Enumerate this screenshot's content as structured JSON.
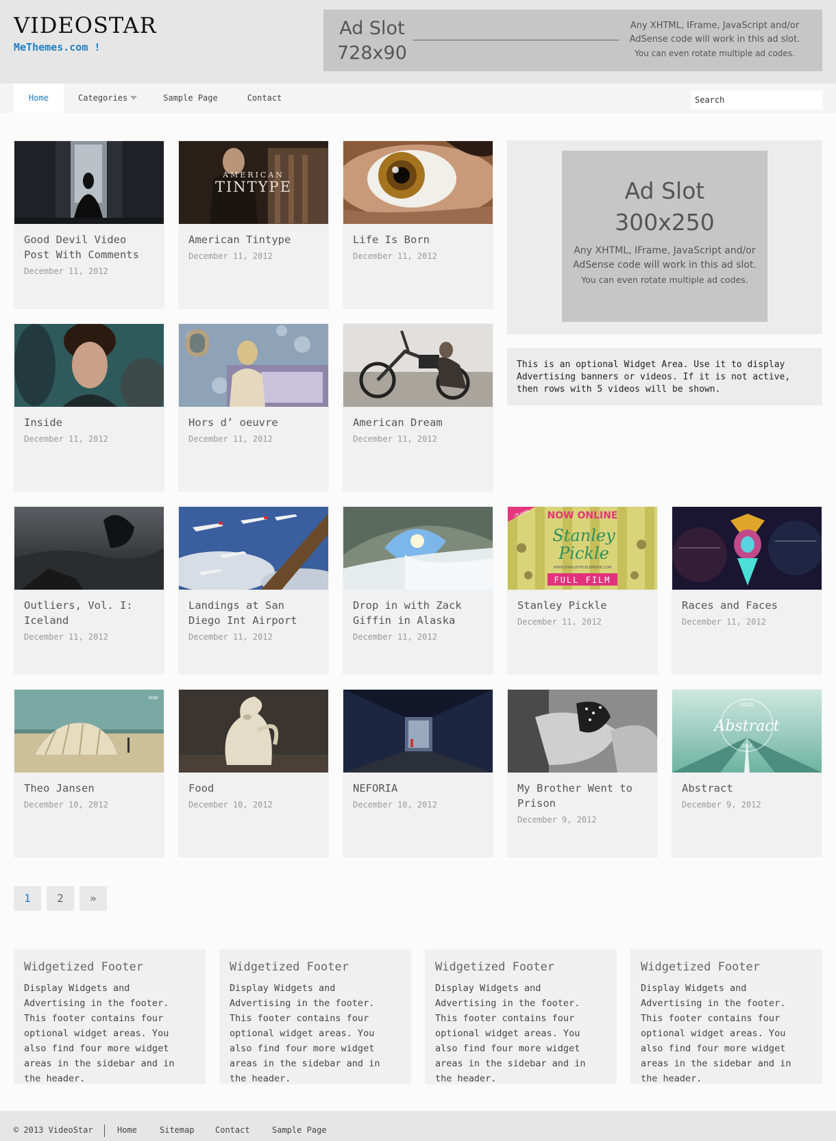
{
  "site": {
    "logo": "VIDEOSTAR",
    "tagline": "MeThemes.com !"
  },
  "ads": {
    "top": {
      "size_line1": "Ad Slot",
      "size_line2": "728x90",
      "desc1": "Any XHTML, IFrame, JavaScript and/or",
      "desc2": "AdSense code will work in this ad slot.",
      "desc3": "You can even rotate multiple ad codes."
    },
    "side": {
      "size_line1": "Ad Slot",
      "size_line2": "300x250",
      "desc1": "Any XHTML, IFrame, JavaScript and/or",
      "desc2": "AdSense code will work in this ad slot.",
      "desc3": "You can even rotate multiple ad codes."
    }
  },
  "nav": {
    "items": [
      "Home",
      "Categories",
      "Sample Page",
      "Contact"
    ],
    "search_placeholder": "Search"
  },
  "widget_text": "This is an optional Widget Area. Use it to display Advertising banners or videos. If it is not active, then rows with 5 videos will be shown.",
  "videos": [
    {
      "title": "Good Devil Video Post With Comments",
      "date": "December 11, 2012",
      "thumb": "dancer-silhouette-window"
    },
    {
      "title": "American Tintype",
      "date": "December 11, 2012",
      "thumb": "american-tintype-workshop"
    },
    {
      "title": "Life Is Born",
      "date": "December 11, 2012",
      "thumb": "eye-closeup"
    },
    {
      "title": "Inside",
      "date": "December 11, 2012",
      "thumb": "crowd-portrait"
    },
    {
      "title": "Hors d’ oeuvre",
      "date": "December 11, 2012",
      "thumb": "woman-floral-wallpaper"
    },
    {
      "title": "American Dream",
      "date": "December 11, 2012",
      "thumb": "motorcycle-rider"
    },
    {
      "title": "Outliers, Vol. I: Iceland",
      "date": "December 11, 2012",
      "thumb": "dark-rocks-iceland"
    },
    {
      "title": "Landings at San Diego Int Airport",
      "date": "December 11, 2012",
      "thumb": "airplanes-sky"
    },
    {
      "title": "Drop in with Zack Giffin in Alaska",
      "date": "December 11, 2012",
      "thumb": "snow-cave-skier"
    },
    {
      "title": "Stanley Pickle",
      "date": "December 11, 2012",
      "thumb": "stanley-pickle-poster",
      "poster": {
        "badge": "iTunes",
        "top": "NOW ONLINE",
        "name1": "Stanley",
        "name2": "Pickle",
        "url": "WWW.STANLEYPICKLEMOVIE.COM",
        "bottom": "FULL FILM"
      }
    },
    {
      "title": "Races and Faces",
      "date": "December 11, 2012",
      "thumb": "abstract-figure-neon"
    },
    {
      "title": "Theo Jansen",
      "date": "December 10, 2012",
      "thumb": "strandbeest-beach"
    },
    {
      "title": "Food",
      "date": "December 10, 2012",
      "thumb": "clay-frog-sculpture"
    },
    {
      "title": "NEFORIA",
      "date": "December 10, 2012",
      "thumb": "abandoned-building"
    },
    {
      "title": "My Brother Went to Prison",
      "date": "December 9, 2012",
      "thumb": "bw-couple"
    },
    {
      "title": "Abstract",
      "date": "December 9, 2012",
      "thumb": "abstract-foggy-road",
      "overlay": {
        "top": "EDLIO",
        "word": "Abstract",
        "year": "2012"
      }
    }
  ],
  "pagination": [
    "1",
    "2",
    "»"
  ],
  "footer_widgets": [
    {
      "title": "Widgetized Footer",
      "text": "Display Widgets and Advertising in the footer. This footer contains four optional widget areas. You also find four more widget areas in the sidebar and in the header."
    },
    {
      "title": "Widgetized Footer",
      "text": "Display Widgets and Advertising in the footer. This footer contains four optional widget areas. You also find four more widget areas in the sidebar and in the header."
    },
    {
      "title": "Widgetized Footer",
      "text": "Display Widgets and Advertising in the footer. This footer contains four optional widget areas. You also find four more widget areas in the sidebar and in the header."
    },
    {
      "title": "Widgetized Footer",
      "text": "Display Widgets and Advertising in the footer. This footer contains four optional widget areas. You also find four more widget areas in the sidebar and in the header."
    }
  ],
  "bottom": {
    "copyright": "© 2013 VideoStar",
    "links": [
      "Home",
      "Sitemap",
      "Contact",
      "Sample Page"
    ]
  },
  "colors": {
    "accent": "#1e7fc2",
    "card_bg": "#f1f1f1",
    "header_bg": "#e6e6e6"
  }
}
